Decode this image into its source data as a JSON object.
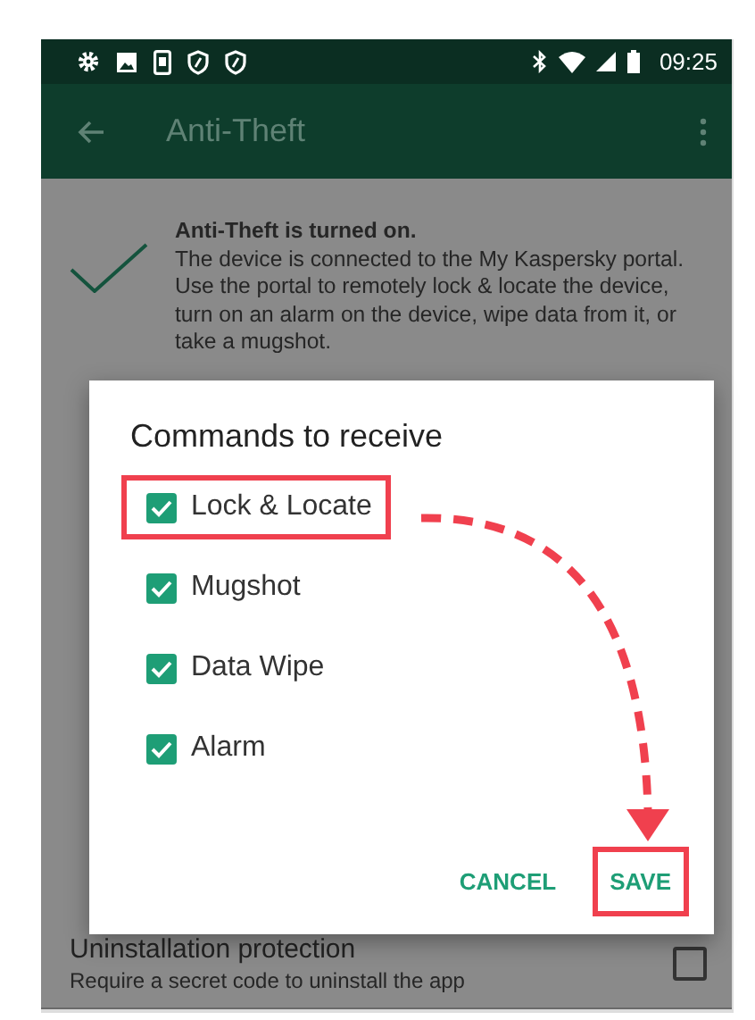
{
  "status_bar": {
    "time": "09:25"
  },
  "toolbar": {
    "title": "Anti-Theft"
  },
  "status": {
    "title": "Anti-Theft is turned on.",
    "description": "The device is connected to the My Kaspersky portal. Use the portal to remotely lock & locate the device, turn on an alarm on the device, wipe data from it, or take a mugshot."
  },
  "settings": [
    {
      "title": "Uninstallation protection",
      "subtitle": "Require a secret code to uninstall the app",
      "checked": false
    }
  ],
  "dialog": {
    "title": "Commands to receive",
    "commands": [
      {
        "label": "Lock & Locate",
        "checked": true,
        "highlighted": true
      },
      {
        "label": "Mugshot",
        "checked": true,
        "highlighted": false
      },
      {
        "label": "Data Wipe",
        "checked": true,
        "highlighted": false
      },
      {
        "label": "Alarm",
        "checked": true,
        "highlighted": false
      }
    ],
    "buttons": [
      {
        "label": "CANCEL",
        "highlighted": false
      },
      {
        "label": "SAVE",
        "highlighted": true
      }
    ]
  }
}
